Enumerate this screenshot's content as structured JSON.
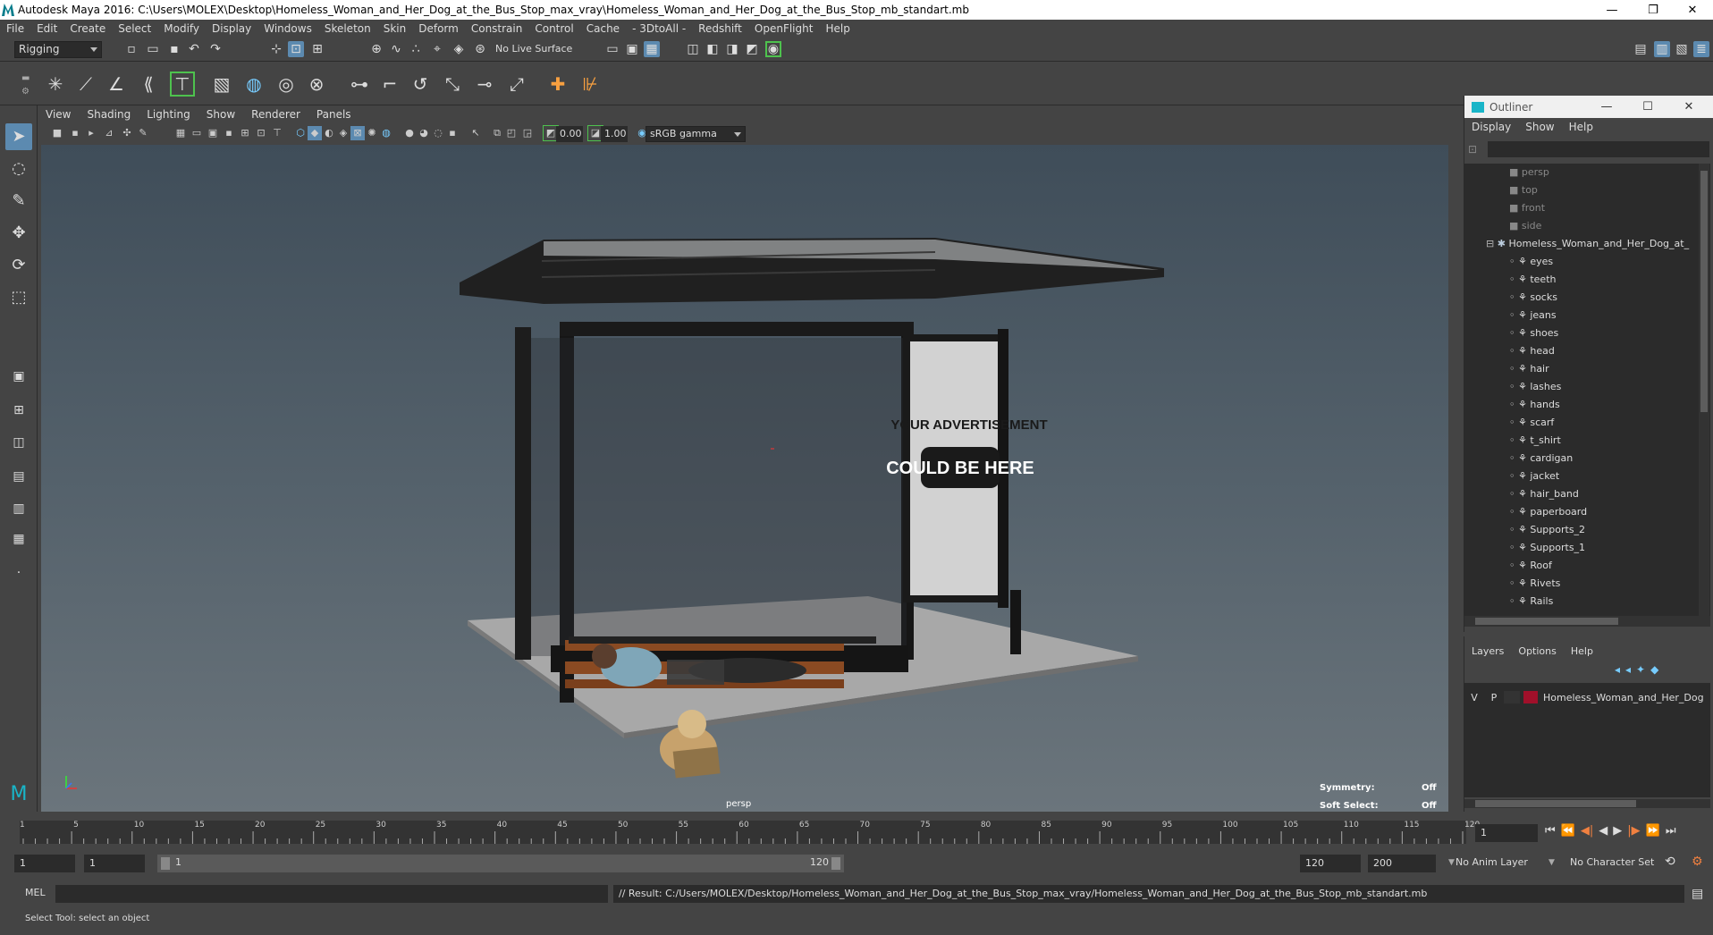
{
  "window": {
    "title": "Autodesk Maya 2016: C:\\Users\\MOLEX\\Desktop\\Homeless_Woman_and_Her_Dog_at_the_Bus_Stop_max_vray\\Homeless_Woman_and_Her_Dog_at_the_Bus_Stop_mb_standart.mb",
    "minimize": "—",
    "restore": "❐",
    "close": "✕"
  },
  "menubar": [
    "File",
    "Edit",
    "Create",
    "Select",
    "Modify",
    "Display",
    "Windows",
    "Skeleton",
    "Skin",
    "Deform",
    "Constrain",
    "Control",
    "Cache",
    "- 3DtoAll -",
    "Redshift",
    "OpenFlight",
    "Help"
  ],
  "statusline": {
    "menuset": "Rigging",
    "live_surface": "No Live Surface"
  },
  "panel": {
    "menus": [
      "View",
      "Shading",
      "Lighting",
      "Show",
      "Renderer",
      "Panels"
    ],
    "exposure": "0.00",
    "gamma": "1.00",
    "color_space": "sRGB gamma"
  },
  "viewport": {
    "camera": "persp",
    "symmetry_label": "Symmetry:",
    "symmetry_value": "Off",
    "soft_select_label": "Soft Select:",
    "soft_select_value": "Off",
    "billboard_line1": "YOUR ADVERTISEMENT",
    "billboard_line2": "COULD BE HERE"
  },
  "outliner": {
    "title": "Outliner",
    "menus": [
      "Display",
      "Show",
      "Help"
    ],
    "cameras": [
      "persp",
      "top",
      "front",
      "side"
    ],
    "root": "Homeless_Woman_and_Her_Dog_at_",
    "children": [
      "eyes",
      "teeth",
      "socks",
      "jeans",
      "shoes",
      "head",
      "hair",
      "lashes",
      "hands",
      "scarf",
      "t_shirt",
      "cardigan",
      "jacket",
      "hair_band",
      "paperboard",
      "Supports_2",
      "Supports_1",
      "Roof",
      "Rivets",
      "Rails"
    ]
  },
  "layers": {
    "menus": [
      "Layers",
      "Options",
      "Help"
    ],
    "row": {
      "v": "V",
      "p": "P",
      "name": "Homeless_Woman_and_Her_Dog",
      "color": "#a0102a"
    }
  },
  "timeline": {
    "ticks": [
      "5",
      "10",
      "15",
      "20",
      "25",
      "30",
      "35",
      "40",
      "45",
      "50",
      "55",
      "60",
      "65",
      "70",
      "75",
      "80",
      "85",
      "90",
      "95",
      "100",
      "105",
      "110",
      "115",
      "120"
    ],
    "start_tick": "1",
    "current_frame": "1"
  },
  "range": {
    "start": "1",
    "playback_start": "1",
    "slider_start": "1",
    "slider_end": "120",
    "playback_end": "120",
    "end": "200",
    "anim_layer": "No Anim Layer",
    "character_set": "No Character Set"
  },
  "cmdline": {
    "lang": "MEL",
    "result": "// Result: C:/Users/MOLEX/Desktop/Homeless_Woman_and_Her_Dog_at_the_Bus_Stop_max_vray/Homeless_Woman_and_Her_Dog_at_the_Bus_Stop_mb_standart.mb"
  },
  "helpline": "Select Tool: select an object"
}
